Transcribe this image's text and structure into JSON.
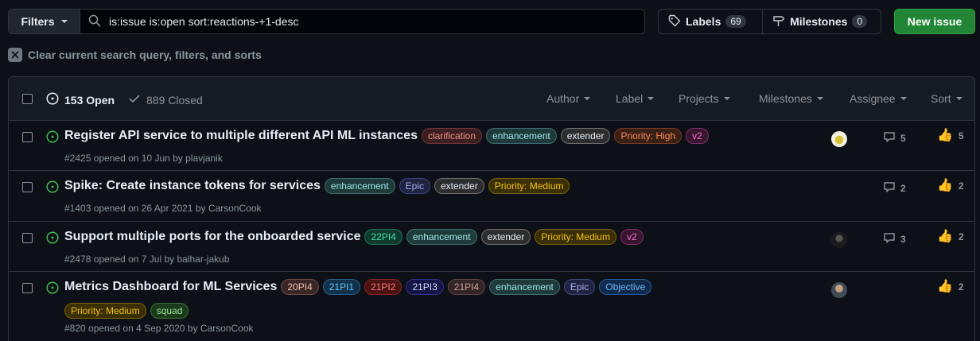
{
  "toolbar": {
    "filters_label": "Filters",
    "search_value": "is:issue is:open sort:reactions-+1-desc",
    "labels_label": "Labels",
    "labels_count": "69",
    "milestones_label": "Milestones",
    "milestones_count": "0",
    "new_issue_label": "New issue"
  },
  "clear_filters_label": "Clear current search query, filters, and sorts",
  "list_header": {
    "open_label": "153 Open",
    "closed_label": "889 Closed",
    "filters": [
      "Author",
      "Label",
      "Projects",
      "Milestones",
      "Assignee",
      "Sort"
    ]
  },
  "issues": [
    {
      "title": "Register API service to multiple different API ML instances",
      "labels": [
        "clarification",
        "enhancement",
        "extender",
        "Priority: High",
        "v2"
      ],
      "meta": "#2425 opened on 10 Jun by plavjanik",
      "comments": "5",
      "reactions": "5",
      "has_avatar": true
    },
    {
      "title": "Spike: Create instance tokens for services",
      "labels": [
        "enhancement",
        "Epic",
        "extender",
        "Priority: Medium"
      ],
      "meta": "#1403 opened on 26 Apr 2021 by CarsonCook",
      "comments": "2",
      "reactions": "2",
      "has_avatar": false
    },
    {
      "title": "Support multiple ports for the onboarded service",
      "labels": [
        "22PI4",
        "enhancement",
        "extender",
        "Priority: Medium",
        "v2"
      ],
      "meta": "#2478 opened on 7 Jul by balhar-jakub",
      "comments": "3",
      "reactions": "2",
      "has_avatar": true
    },
    {
      "title": "Metrics Dashboard for ML Services",
      "labels": [
        "20PI4",
        "21PI1",
        "21PI2",
        "21PI3",
        "21PI4",
        "enhancement",
        "Epic",
        "Objective"
      ],
      "labels_line2": [
        "Priority: Medium",
        "squad"
      ],
      "meta": "#820 opened on 4 Sep 2020 by CarsonCook",
      "comments": "",
      "reactions": "2",
      "has_avatar": true
    }
  ],
  "label_colors": {
    "clarification": {
      "bg": "#3b1f1f",
      "fg": "#f08d8d",
      "bd": "#6e3434"
    },
    "enhancement": {
      "bg": "#1e3a3a",
      "fg": "#9fe6e6",
      "bd": "#3c6e6e"
    },
    "extender": {
      "bg": "#2d2d2d",
      "fg": "#e6edf3",
      "bd": "#6e6e6e"
    },
    "Priority: High": {
      "bg": "#3a1f14",
      "fg": "#f58a5c",
      "bd": "#7a3b24"
    },
    "Priority: Medium": {
      "bg": "#3a2f05",
      "fg": "#f4c20d",
      "bd": "#7a6200"
    },
    "v2": {
      "bg": "#3a1530",
      "fg": "#f06fc8",
      "bd": "#7a2d66"
    },
    "Epic": {
      "bg": "#1f2340",
      "fg": "#a4acef",
      "bd": "#3d4480"
    },
    "Objective": {
      "bg": "#0f2a4a",
      "fg": "#6fb6ff",
      "bd": "#245a99"
    },
    "22PI4": {
      "bg": "#0f3a2f",
      "fg": "#3ee0a8",
      "bd": "#1e7055"
    },
    "20PI4": {
      "bg": "#3a2623",
      "fg": "#f0c2b8",
      "bd": "#6e4a44"
    },
    "21PI1": {
      "bg": "#11324a",
      "fg": "#6ec3f7",
      "bd": "#255f8a"
    },
    "21PI2": {
      "bg": "#4a1212",
      "fg": "#ff7b7b",
      "bd": "#8a2525"
    },
    "21PI3": {
      "bg": "#141447",
      "fg": "#dcdcff",
      "bd": "#33338a"
    },
    "21PI4": {
      "bg": "#332525",
      "fg": "#c9a0a0",
      "bd": "#5e4343"
    },
    "squad": {
      "bg": "#1b3a1b",
      "fg": "#9be39b",
      "bd": "#356e35"
    }
  }
}
